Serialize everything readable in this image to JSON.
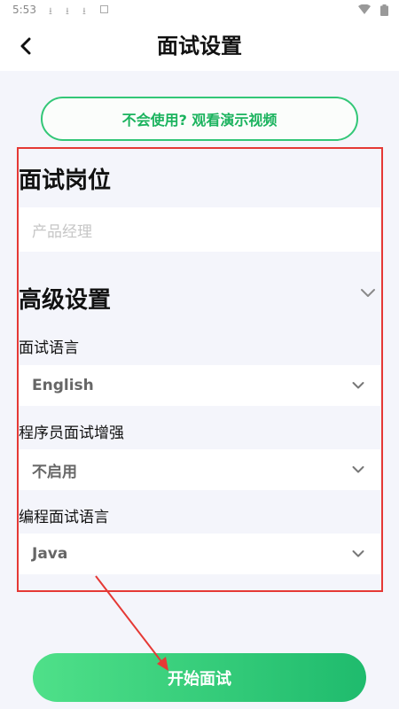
{
  "status_bar": {
    "time": "5:53",
    "download_icons": [
      "⭳",
      "⭳",
      "⭳"
    ]
  },
  "header": {
    "title": "面试设置"
  },
  "demo_button": {
    "label": "不会使用? 观看演示视频"
  },
  "position": {
    "title": "面试岗位",
    "placeholder": "产品经理"
  },
  "advanced": {
    "title": "高级设置",
    "interview_language": {
      "label": "面试语言",
      "value": "English"
    },
    "programmer_enhance": {
      "label": "程序员面试增强",
      "value": "不启用"
    },
    "coding_language": {
      "label": "编程面试语言",
      "value": "Java"
    }
  },
  "start_button": {
    "label": "开始面试"
  },
  "colors": {
    "accent": "#1bb35e",
    "annotation_red": "#e53935",
    "background": "#f4f5fb"
  }
}
